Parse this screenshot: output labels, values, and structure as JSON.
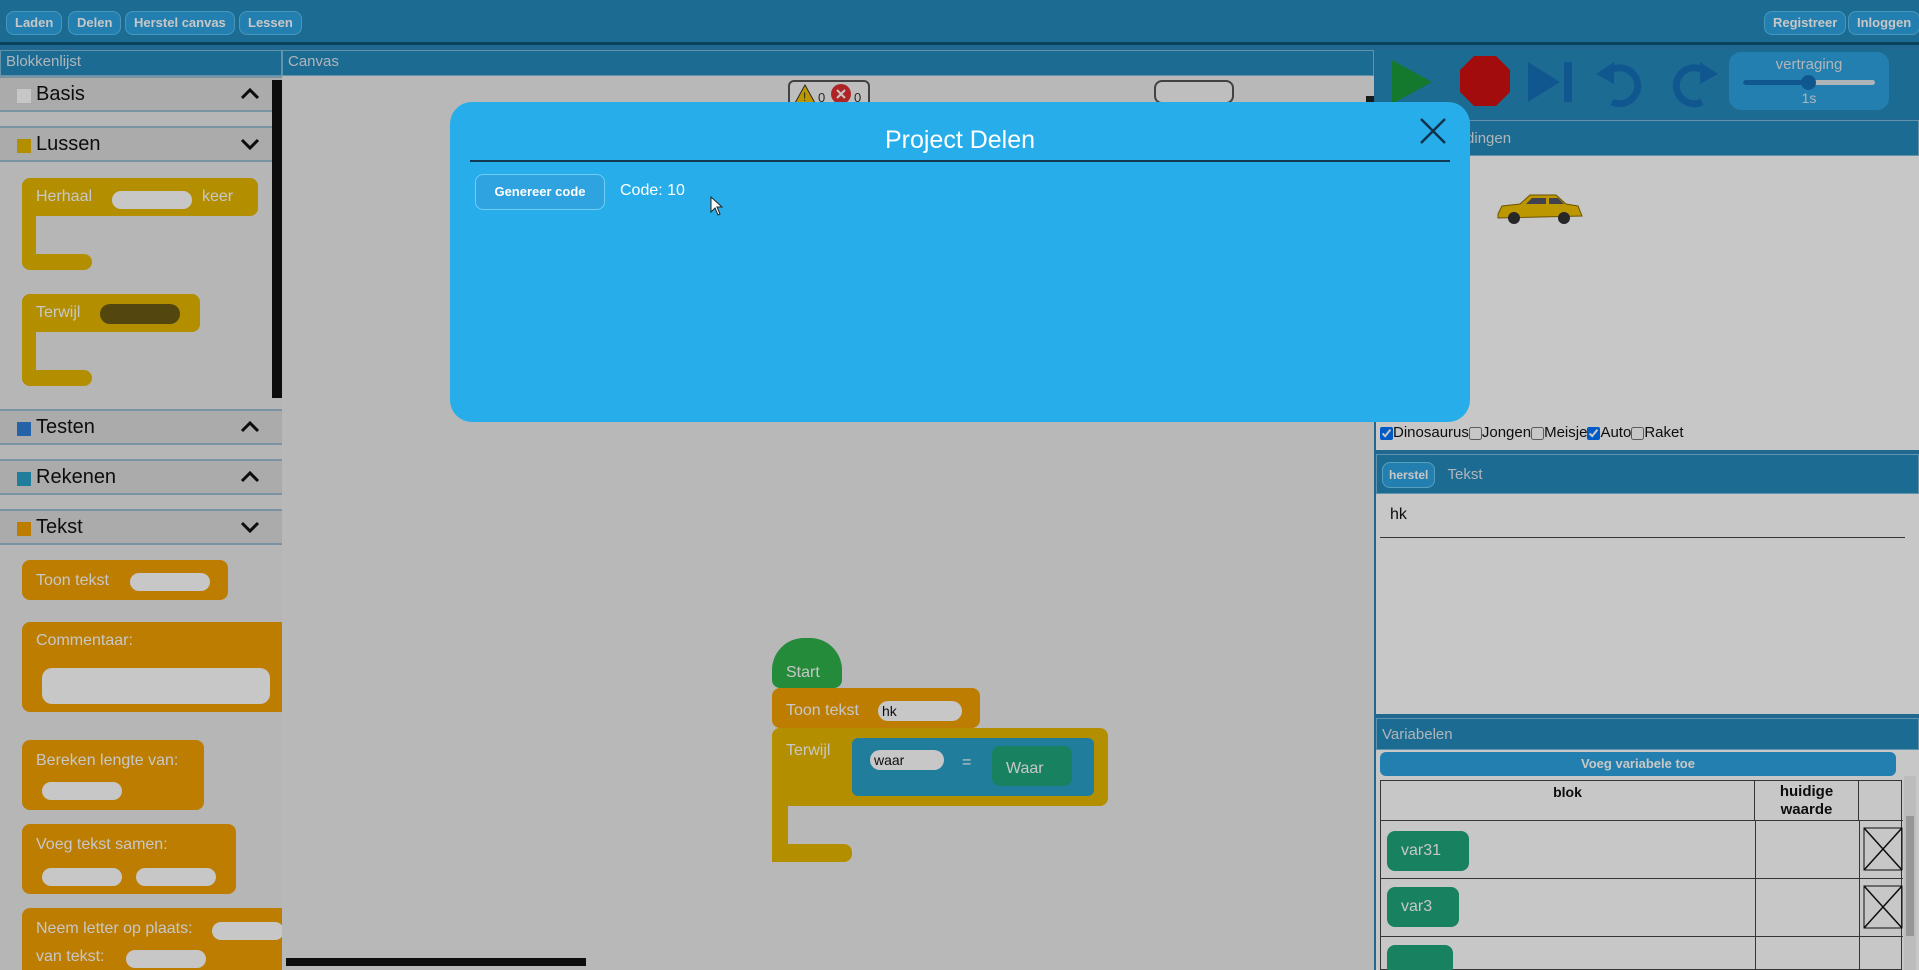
{
  "topbar": {
    "left_buttons": [
      "Laden",
      "Delen",
      "Herstel canvas",
      "Lessen"
    ],
    "right_buttons": [
      "Registreer",
      "Inloggen"
    ]
  },
  "blocklist": {
    "title": "Blokkenlijst",
    "categories": [
      {
        "label": "Basis",
        "color": "#ffffff",
        "state": "collapsed"
      },
      {
        "label": "Lussen",
        "color": "#e6b800",
        "state": "expanded"
      },
      {
        "label": "Testen",
        "color": "#2f7fd6",
        "state": "collapsed"
      },
      {
        "label": "Rekenen",
        "color": "#2aa0c8",
        "state": "collapsed"
      },
      {
        "label": "Tekst",
        "color": "#f2a000",
        "state": "expanded"
      }
    ],
    "blocks": {
      "herhaal": "Herhaal",
      "keer": "keer",
      "terwijl": "Terwijl",
      "toon_tekst": "Toon tekst",
      "commentaar": "Commentaar:",
      "bereken_lengte": "Bereken lengte van:",
      "voeg_samen": "Voeg tekst samen:",
      "neem_letter": "Neem letter op plaats:",
      "van_tekst": "van tekst:"
    }
  },
  "canvas": {
    "title": "Canvas",
    "warning_count": "0",
    "error_count": "0",
    "program": {
      "start": "Start",
      "toon_tekst": "Toon tekst",
      "toon_value": "hk",
      "terwijl": "Terwijl",
      "compare_left": "waar",
      "operator": "=",
      "compare_right": "Waar"
    }
  },
  "controls": {
    "delay_label": "vertraging",
    "delay_value": "1s",
    "delay_fraction": 0.5
  },
  "stage": {
    "title": "Afbeeldingen",
    "title_visible": "eeldingen",
    "sprites": [
      {
        "label": "Dinosaurus",
        "checked": true
      },
      {
        "label": "Jongen",
        "checked": false
      },
      {
        "label": "Meisje",
        "checked": false
      },
      {
        "label": "Auto",
        "checked": true
      },
      {
        "label": "Raket",
        "checked": false
      }
    ]
  },
  "text_panel": {
    "reset_label": "herstel",
    "title": "Tekst",
    "output": "hk"
  },
  "variables": {
    "title": "Variabelen",
    "add_label": "Voeg variabele toe",
    "col_block": "blok",
    "col_value": "huidige waarde",
    "rows": [
      {
        "name": "var31",
        "value": ""
      },
      {
        "name": "var3",
        "value": ""
      }
    ]
  },
  "modal": {
    "title": "Project Delen",
    "generate_label": "Genereer code",
    "code_text": "Code: 10"
  },
  "colors": {
    "accent": "#27aeea",
    "header": "#2589bd",
    "block_orange": "#f2a000",
    "block_yellow": "#e6b800",
    "start_green": "#2db34a",
    "var_green": "#1fa67a"
  }
}
